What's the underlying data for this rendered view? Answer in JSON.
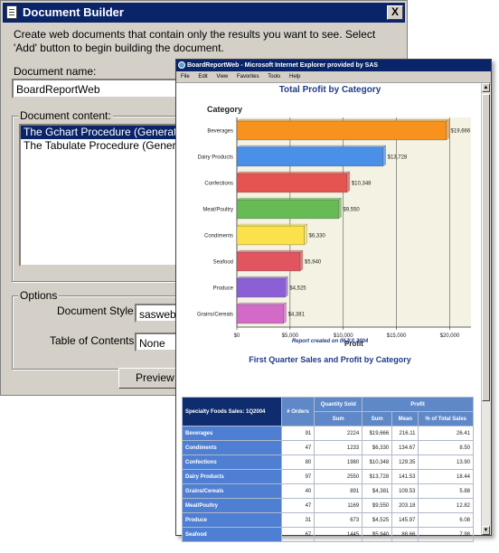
{
  "dialog": {
    "title": "Document Builder",
    "close_glyph": "X",
    "intro": "Create web documents that contain only the results you want to see.  Select 'Add' button to begin building the document.",
    "doc_name_label": "Document name:",
    "doc_name_value": "BoardReportWeb",
    "content_label": "Document content:",
    "content_items": [
      "The Gchart Procedure (Generated f",
      "The Tabulate Procedure (Generated"
    ],
    "options_label": "Options",
    "style_label": "Document Style:",
    "style_value": "sasweb",
    "toc_label": "Table of Contents:",
    "toc_value": "None",
    "preview_label": "Preview"
  },
  "browser": {
    "title": "BoardReportWeb - Microsoft Internet Explorer provided by SAS",
    "menu": [
      "File",
      "Edit",
      "View",
      "Favorites",
      "Tools",
      "Help"
    ]
  },
  "chart_data": {
    "type": "bar",
    "orientation": "horizontal",
    "title": "Total Profit by Category",
    "ylabel": "Category",
    "xlabel": "Profit",
    "categories": [
      "Beverages",
      "Dairy Products",
      "Confections",
      "Meat/Poultry",
      "Condiments",
      "Seafood",
      "Produce",
      "Grains/Cereals"
    ],
    "values": [
      19666,
      13728,
      10348,
      9550,
      6330,
      5940,
      4525,
      4381
    ],
    "value_labels": [
      "$19,666",
      "$13,728",
      "$10,348",
      "$9,550",
      "$6,330",
      "$5,940",
      "$4,525",
      "$4,381"
    ],
    "colors": [
      "#f7921e",
      "#4a8fe8",
      "#e55450",
      "#66bb55",
      "#fbe14a",
      "#e05560",
      "#8b5fd6",
      "#d36ac8"
    ],
    "xlim": [
      0,
      22000
    ],
    "ticks": [
      0,
      5000,
      10000,
      15000,
      20000
    ],
    "tick_labels": [
      "$0",
      "$5,000",
      "$10,000",
      "$15,000",
      "$20,000"
    ],
    "grid": true
  },
  "report_note": "Report created on 06JUL2004",
  "table": {
    "title": "First Quarter Sales and Profit by Category",
    "corner": "Specialty Foods Sales: 1Q2004",
    "h_orders": "# Orders",
    "h_qty": "Quantity Sold",
    "h_profit": "Profit",
    "h_sum": "Sum",
    "h_psum": "Sum",
    "h_mean": "Mean",
    "h_pct": "% of Total Sales",
    "rows": [
      {
        "cat": "Beverages",
        "orders": "91",
        "qty": "2224",
        "sum": "$19,666",
        "mean": "216.11",
        "pct": "26.41"
      },
      {
        "cat": "Condiments",
        "orders": "47",
        "qty": "1233",
        "sum": "$6,330",
        "mean": "134.67",
        "pct": "8.50"
      },
      {
        "cat": "Confections",
        "orders": "80",
        "qty": "1980",
        "sum": "$10,348",
        "mean": "129.35",
        "pct": "13.90"
      },
      {
        "cat": "Dairy Products",
        "orders": "97",
        "qty": "2550",
        "sum": "$13,728",
        "mean": "141.53",
        "pct": "18.44"
      },
      {
        "cat": "Grains/Cereals",
        "orders": "40",
        "qty": "891",
        "sum": "$4,381",
        "mean": "109.53",
        "pct": "5.88"
      },
      {
        "cat": "Meat/Poultry",
        "orders": "47",
        "qty": "1169",
        "sum": "$9,550",
        "mean": "203.18",
        "pct": "12.82"
      },
      {
        "cat": "Produce",
        "orders": "31",
        "qty": "673",
        "sum": "$4,525",
        "mean": "145.97",
        "pct": "6.08"
      },
      {
        "cat": "Seafood",
        "orders": "67",
        "qty": "1445",
        "sum": "$5,940",
        "mean": "88.66",
        "pct": "7.98"
      }
    ]
  }
}
